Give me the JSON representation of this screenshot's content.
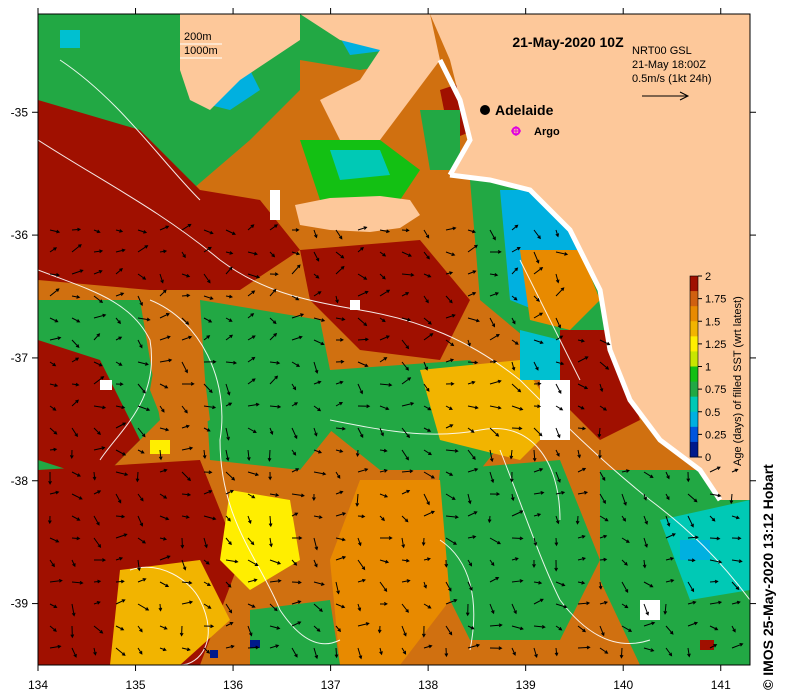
{
  "map": {
    "title": "21-May-2020 10Z",
    "lon_ticks": [
      "134",
      "135",
      "136",
      "137",
      "138",
      "139",
      "140",
      "141"
    ],
    "lat_ticks": [
      "-35",
      "-36",
      "-37",
      "-38",
      "-39"
    ],
    "lon_range": [
      134.0,
      141.3
    ],
    "lat_range": [
      -39.5,
      -34.2
    ],
    "depth_legend": {
      "line1": "200m",
      "line2": "1000m"
    },
    "current_info": {
      "line1": "NRT00 GSL",
      "line2": "21-May 18:00Z",
      "line3": "0.5m/s (1kt 24h)"
    },
    "places": [
      {
        "name": "Adelaide",
        "symbol": "black-dot",
        "lon": 138.6,
        "lat": -34.93
      },
      {
        "name": "Argo",
        "symbol": "magenta-float-marker",
        "lon": 138.9,
        "lat": -35.12
      }
    ],
    "colorbar": {
      "label": "Age (days) of filled SST (wrt latest)",
      "ticks": [
        "2",
        "1.75",
        "1.5",
        "1.25",
        "1",
        "0.75",
        "0.5",
        "0.25",
        "0"
      ],
      "range": [
        0,
        2
      ],
      "colors": [
        "#001a8c",
        "#0055dd",
        "#00b0e0",
        "#00c9b5",
        "#22a844",
        "#13c013",
        "#c8e600",
        "#ffee00",
        "#f2b400",
        "#e88a00",
        "#d06010",
        "#a01000"
      ]
    },
    "credit": "© IMOS 25-May-2020 13:12 Hobart",
    "colors": {
      "land": "#fdc89a",
      "coast_white": "#ffffff",
      "age_0_dark_blue": "#001a8c",
      "age_0_75_cyan": "#00c0d0",
      "age_1_green": "#22a844",
      "age_1_25_yellow": "#ffee00",
      "age_1_5_orange": "#e88a00",
      "age_2_dark_red": "#a01000"
    }
  }
}
